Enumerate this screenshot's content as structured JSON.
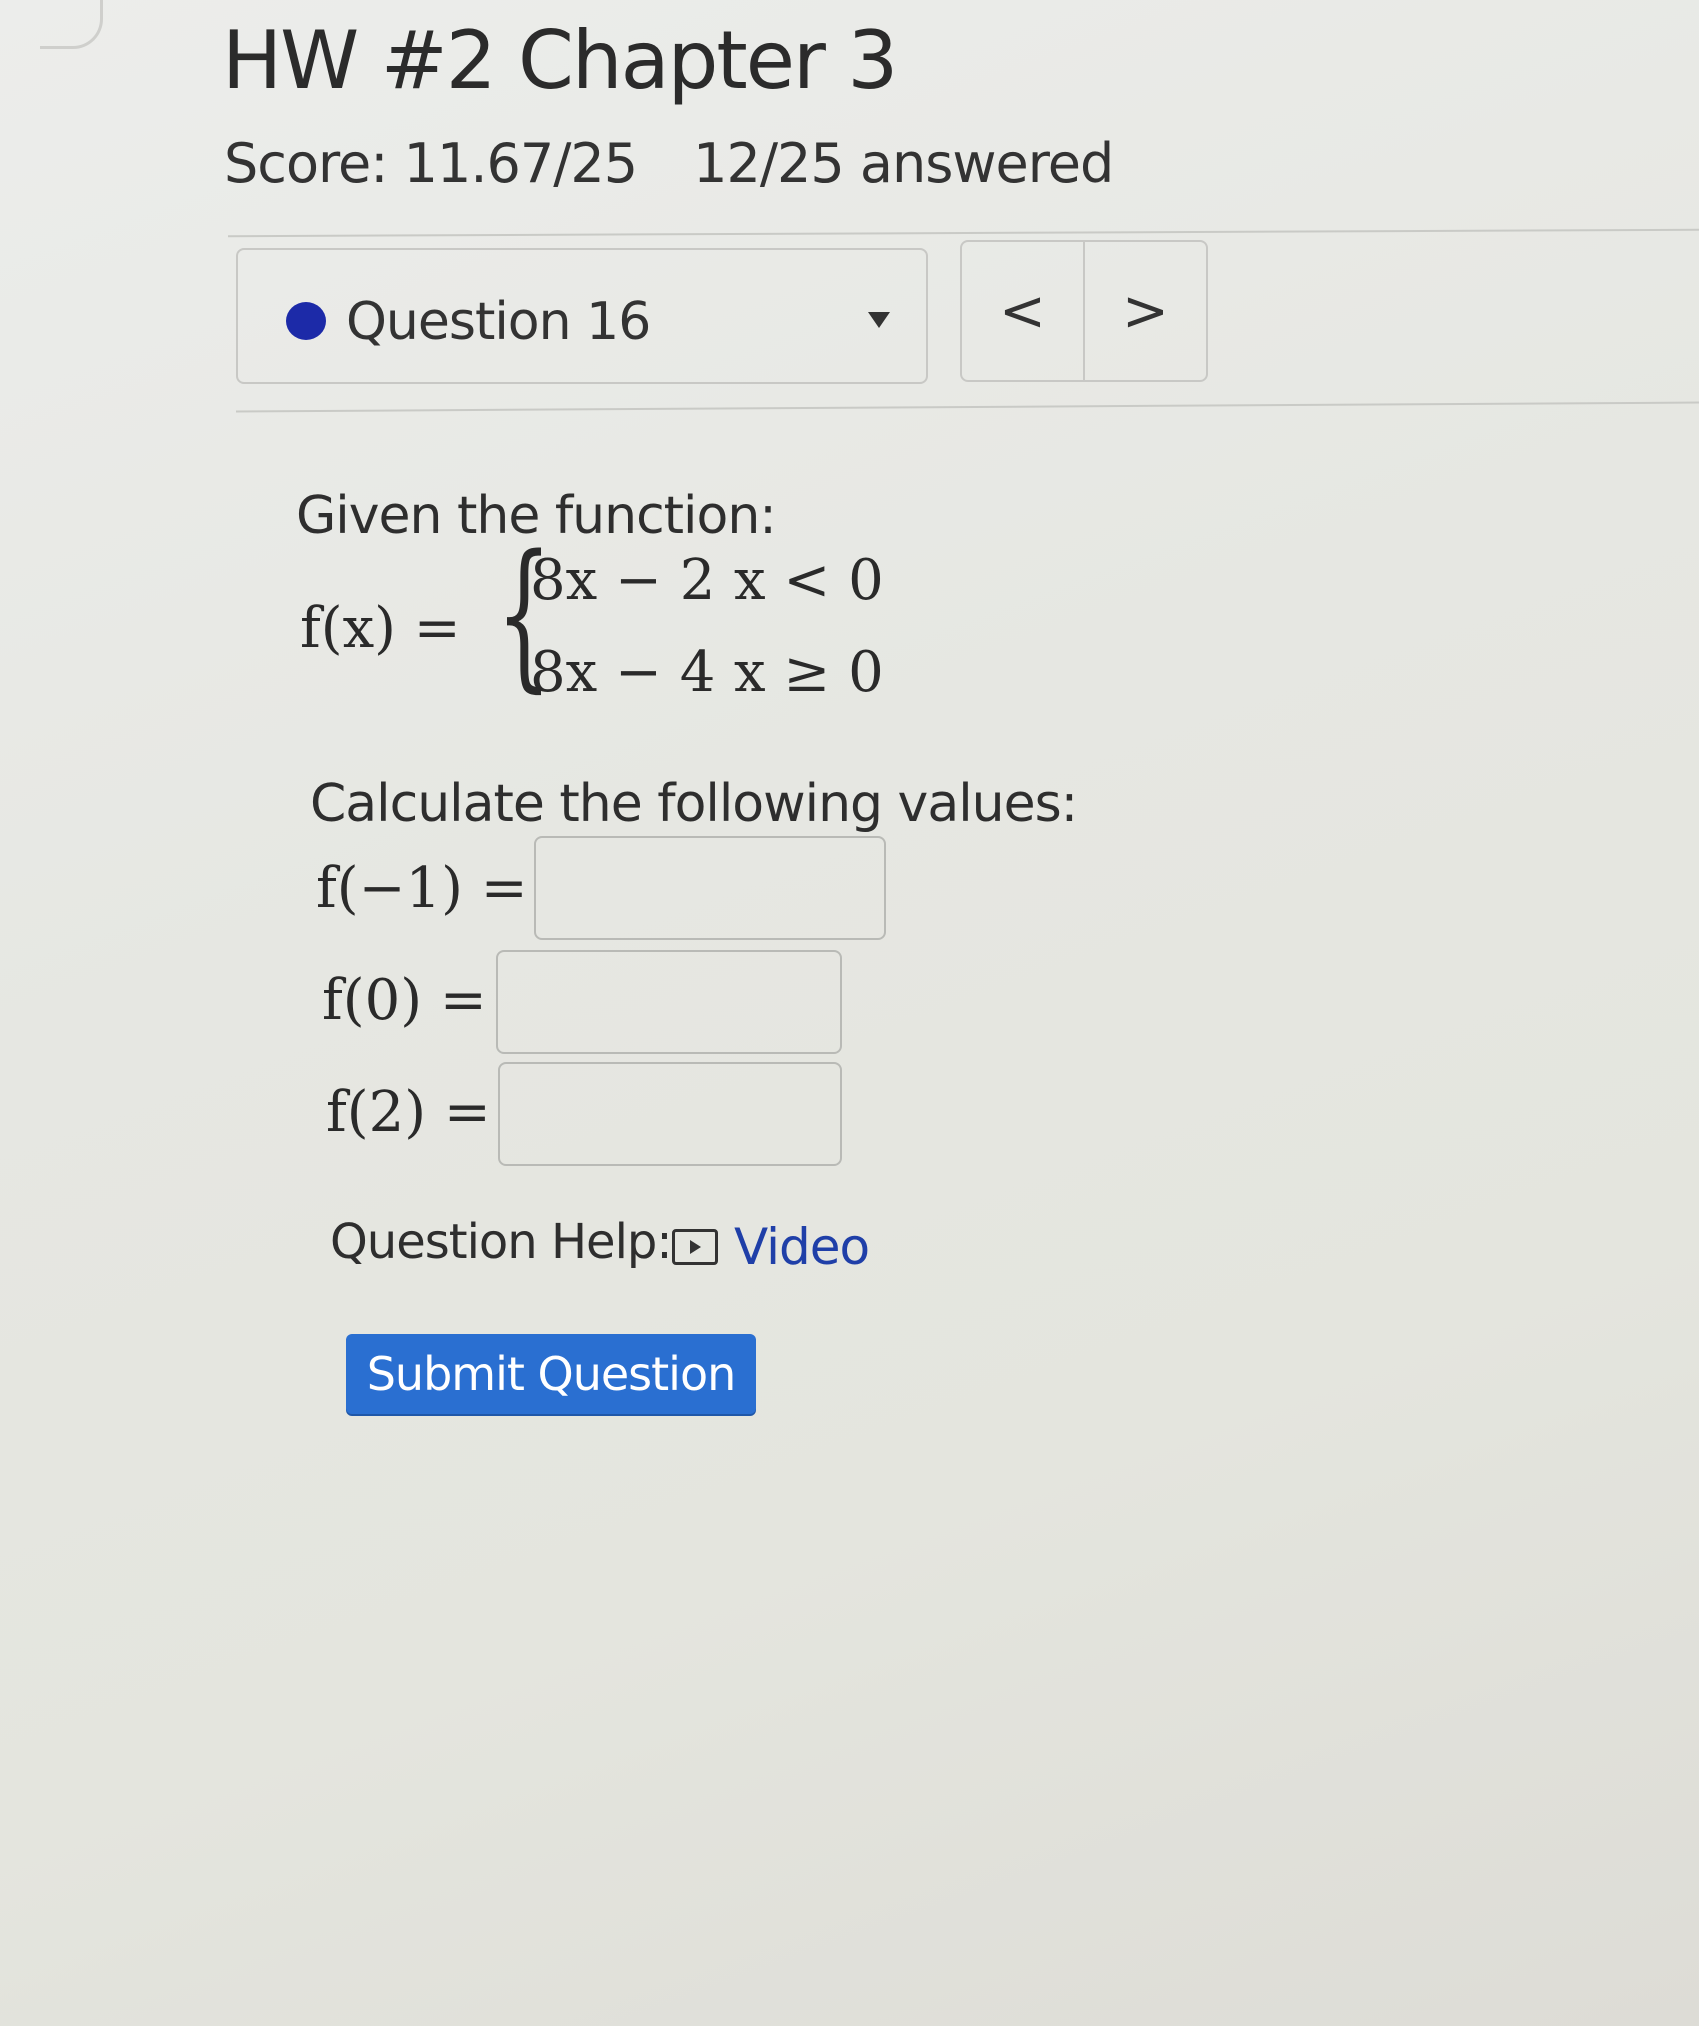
{
  "header": {
    "title": "HW #2 Chapter 3",
    "score": "Score: 11.67/25",
    "answered": "12/25 answered"
  },
  "question_nav": {
    "current_label": "Question 16",
    "prev_symbol": "<",
    "next_symbol": ">",
    "status_color": "#1c2aa8"
  },
  "problem": {
    "intro": "Given the function:",
    "lhs": "f(x) =",
    "pieces": [
      {
        "expr": "8x − 2",
        "cond": "x < 0"
      },
      {
        "expr": "8x − 4",
        "cond": "x ≥ 0"
      }
    ],
    "prompt": "Calculate the following values:",
    "answers": [
      {
        "label": "f(−1) =",
        "value": "",
        "placeholder": ""
      },
      {
        "label": "f(0) =",
        "value": "",
        "placeholder": ""
      },
      {
        "label": "f(2) =",
        "value": "",
        "placeholder": ""
      }
    ]
  },
  "help": {
    "label": "Question Help:",
    "video_label": "Video",
    "link_color": "#1f3fa8"
  },
  "actions": {
    "submit_label": "Submit Question",
    "submit_color": "#2a6fd1"
  }
}
